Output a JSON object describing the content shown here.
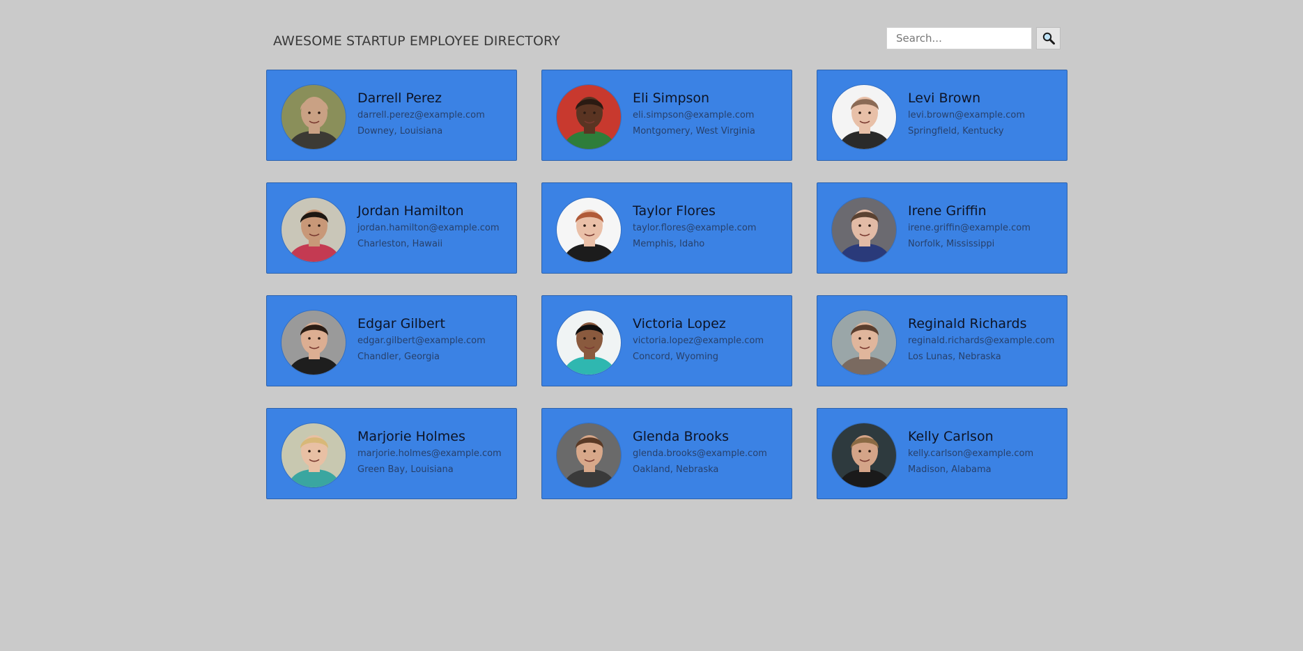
{
  "header": {
    "title": "AWESOME STARTUP EMPLOYEE DIRECTORY"
  },
  "search": {
    "placeholder": "Search...",
    "value": "",
    "button_icon": "search-icon"
  },
  "colors": {
    "background": "#cacaca",
    "card": "#3b82e4",
    "card_border": "#2c62ad"
  },
  "employees": [
    {
      "name": "Darrell Perez",
      "email": "darrell.perez@example.com",
      "location": "Downey, Louisiana",
      "avatar": {
        "bg": "#8a8f5a",
        "skin": "#c9a184",
        "hair": "#c9a184",
        "shirt": "#3c3a34"
      }
    },
    {
      "name": "Eli Simpson",
      "email": "eli.simpson@example.com",
      "location": "Montgomery, West Virginia",
      "avatar": {
        "bg": "#c8392e",
        "skin": "#5a3422",
        "hair": "#2a1a12",
        "shirt": "#2e7d3a"
      }
    },
    {
      "name": "Levi Brown",
      "email": "levi.brown@example.com",
      "location": "Springfield, Kentucky",
      "avatar": {
        "bg": "#f4f4f4",
        "skin": "#e8c0a8",
        "hair": "#8a6a55",
        "shirt": "#2a2a2a"
      }
    },
    {
      "name": "Jordan Hamilton",
      "email": "jordan.hamilton@example.com",
      "location": "Charleston, Hawaii",
      "avatar": {
        "bg": "#c9c6b8",
        "skin": "#c89878",
        "hair": "#1d1712",
        "shirt": "#c43a52"
      }
    },
    {
      "name": "Taylor Flores",
      "email": "taylor.flores@example.com",
      "location": "Memphis, Idaho",
      "avatar": {
        "bg": "#f6f6f6",
        "skin": "#eac0a8",
        "hair": "#b05a38",
        "shirt": "#1c1c1c"
      }
    },
    {
      "name": "Irene Griffin",
      "email": "irene.griffin@example.com",
      "location": "Norfolk, Mississippi",
      "avatar": {
        "bg": "#6b6a70",
        "skin": "#e2bba6",
        "hair": "#5a4232",
        "shirt": "#2a3a7a"
      }
    },
    {
      "name": "Edgar Gilbert",
      "email": "edgar.gilbert@example.com",
      "location": "Chandler, Georgia",
      "avatar": {
        "bg": "#9a9a9a",
        "skin": "#dcae92",
        "hair": "#2a1c14",
        "shirt": "#1e1e1e"
      }
    },
    {
      "name": "Victoria Lopez",
      "email": "victoria.lopez@example.com",
      "location": "Concord, Wyoming",
      "avatar": {
        "bg": "#f0f4f4",
        "skin": "#8a5a3e",
        "hair": "#0e0e0e",
        "shirt": "#2fb7b0"
      }
    },
    {
      "name": "Reginald Richards",
      "email": "reginald.richards@example.com",
      "location": "Los Lunas, Nebraska",
      "avatar": {
        "bg": "#9aa6a8",
        "skin": "#e0b69c",
        "hair": "#5a3e2e",
        "shirt": "#7a6a60"
      }
    },
    {
      "name": "Marjorie Holmes",
      "email": "marjorie.holmes@example.com",
      "location": "Green Bay, Louisiana",
      "avatar": {
        "bg": "#c8c8b0",
        "skin": "#e8c0a4",
        "hair": "#d8b878",
        "shirt": "#3aa6a0"
      }
    },
    {
      "name": "Glenda Brooks",
      "email": "glenda.brooks@example.com",
      "location": "Oakland, Nebraska",
      "avatar": {
        "bg": "#6a6a6a",
        "skin": "#d8a88a",
        "hair": "#5a3a26",
        "shirt": "#3a3a3a"
      }
    },
    {
      "name": "Kelly Carlson",
      "email": "kelly.carlson@example.com",
      "location": "Madison, Alabama",
      "avatar": {
        "bg": "#2e3a3e",
        "skin": "#d4a488",
        "hair": "#8a6a44",
        "shirt": "#1a1a1a"
      }
    }
  ]
}
